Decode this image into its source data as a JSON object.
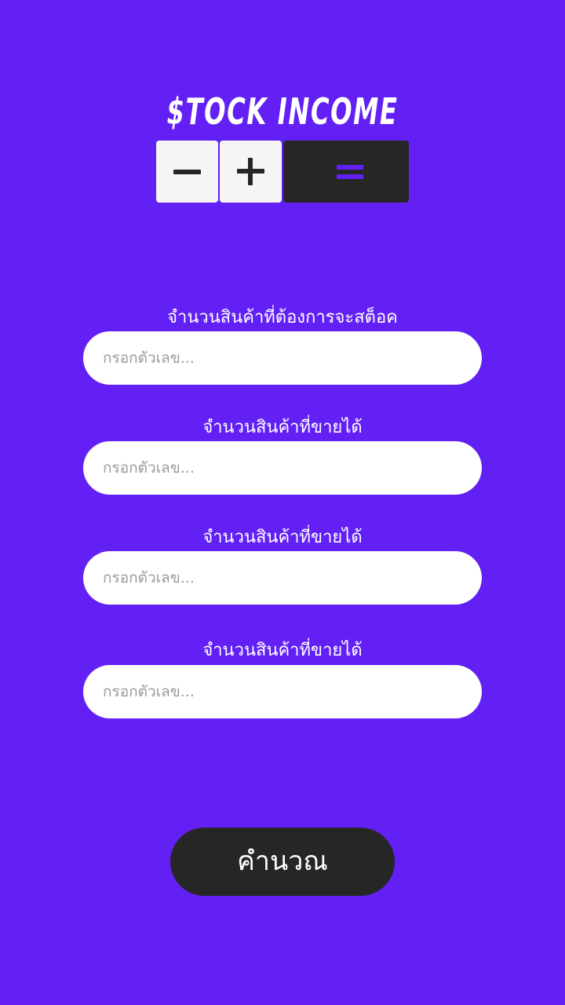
{
  "header": {
    "title": "$TOCK INCOME",
    "logo_tiles": [
      {
        "icon": "minus-icon",
        "background": "#f5f5f5",
        "glyph_color": "#262626"
      },
      {
        "icon": "plus-icon",
        "background": "#f5f5f5",
        "glyph_color": "#262626"
      },
      {
        "icon": "equals-icon",
        "background": "#262626",
        "glyph_color": "#6220f5"
      }
    ]
  },
  "form": {
    "fields": [
      {
        "label": "จำนวนสินค้าที่ต้องการจะสต็อค",
        "placeholder": "กรอกตัวเลข..."
      },
      {
        "label": "จำนวนสินค้าที่ขายได้",
        "placeholder": "กรอกตัวเลข..."
      },
      {
        "label": "จำนวนสินค้าที่ขายได้",
        "placeholder": "กรอกตัวเลข..."
      },
      {
        "label": "จำนวนสินค้าที่ขายได้",
        "placeholder": "กรอกตัวเลข..."
      }
    ],
    "submit_label": "คำนวณ"
  },
  "colors": {
    "background": "#6220f5",
    "dark": "#262626",
    "light": "#f5f5f5",
    "input_background": "#ffffff",
    "placeholder": "#9a9a9a"
  }
}
